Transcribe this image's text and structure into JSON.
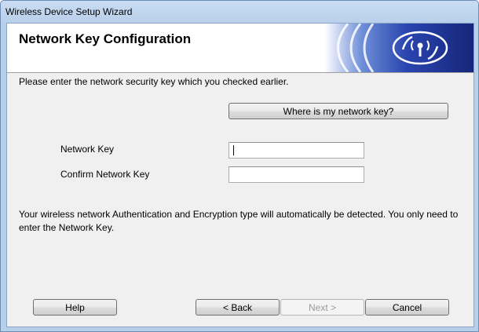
{
  "window": {
    "title": "Wireless Device Setup Wizard"
  },
  "header": {
    "title": "Network Key Configuration",
    "banner_icon": "wifi-signal-icon"
  },
  "intro_text": "Please enter the network security key which you checked earlier.",
  "where_key_button": "Where is my network key?",
  "form": {
    "network_key": {
      "label": "Network Key",
      "value": ""
    },
    "confirm_key": {
      "label": "Confirm Network Key",
      "value": ""
    }
  },
  "note": "Your wireless network Authentication and Encryption type will automatically be detected. You only need to enter the Network Key.",
  "footer": {
    "help": "Help",
    "back": "< Back",
    "next": "Next >",
    "cancel": "Cancel"
  },
  "colors": {
    "banner_dark": "#1c2f8a",
    "banner_light": "#3f67c8"
  }
}
